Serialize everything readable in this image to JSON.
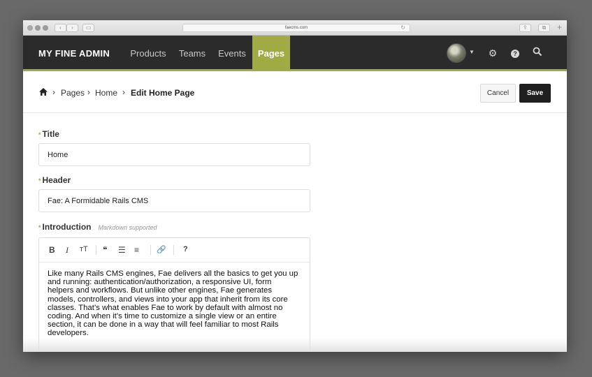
{
  "browser": {
    "url": "faecms.com",
    "reload_glyph": "↻",
    "back_glyph": "‹",
    "forward_glyph": "›",
    "sidebar_glyph": "▭",
    "share_glyph": "⇪",
    "tabs_glyph": "⧉",
    "new_tab_glyph": "+"
  },
  "app": {
    "brand": "MY FINE ADMIN",
    "nav": {
      "products": "Products",
      "teams": "Teams",
      "events": "Events",
      "pages": "Pages"
    },
    "accent_color": "#a0ab43",
    "topbar_color": "#2b2b2b",
    "caret_glyph": "▼",
    "gear_glyph": "⚙",
    "help_glyph": "?"
  },
  "header": {
    "breadcrumb": {
      "separator": "›",
      "pages": "Pages",
      "home": "Home",
      "current": "Edit Home Page"
    },
    "cancel_label": "Cancel",
    "save_label": "Save"
  },
  "form": {
    "required_mark": "*",
    "title_label": "Title",
    "title_value": "Home",
    "header_label": "Header",
    "header_value": "Fae: A Formidable Rails CMS",
    "intro_label": "Introduction",
    "intro_hint": "Markdown supported",
    "toolbar": {
      "bold": "B",
      "italic": "I",
      "heading": "тT",
      "quote": "❝",
      "bullet_list": "☰",
      "numbered_list": "≡",
      "link": "🔗",
      "help": "?"
    },
    "intro_lines": [
      "Like many Rails CMS engines, Fae delivers all the basics to get you up",
      "and running: authentication/authorization, a responsive UI, form",
      "helpers and workflows. But unlike other engines, Fae generates",
      "models, controllers, and views into your app that inherit from its core",
      "classes. That’s what enables Fae to work by default with almost no",
      "coding. And when it’s time to customize a single view or an entire",
      "section, it can be done in a way that will feel familiar to most Rails",
      "developers."
    ]
  }
}
